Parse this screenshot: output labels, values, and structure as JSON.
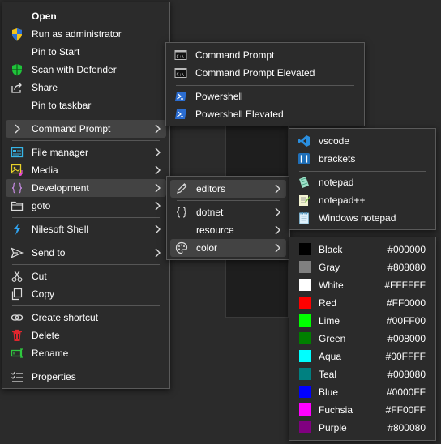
{
  "main_menu": {
    "open": "Open",
    "run_as_admin": "Run as administrator",
    "pin_to_start": "Pin to Start",
    "scan_defender": "Scan with Defender",
    "share": "Share",
    "pin_to_taskbar": "Pin to taskbar",
    "command_prompt": "Command Prompt",
    "file_manager": "File manager",
    "media": "Media",
    "development": "Development",
    "goto": "goto",
    "nilesoft_shell": "Nilesoft Shell",
    "send_to": "Send to",
    "cut": "Cut",
    "copy": "Copy",
    "create_shortcut": "Create shortcut",
    "delete": "Delete",
    "rename": "Rename",
    "properties": "Properties"
  },
  "cmd_menu": {
    "command_prompt": "Command Prompt",
    "command_prompt_elevated": "Command Prompt Elevated",
    "powershell": "Powershell",
    "powershell_elevated": "Powershell Elevated"
  },
  "dev_menu": {
    "editors": "editors",
    "dotnet": "dotnet",
    "resource": "resource",
    "color": "color"
  },
  "editors_menu": {
    "vscode": "vscode",
    "brackets": "brackets",
    "notepad": "notepad",
    "notepadpp": "notepad++",
    "windows_notepad": "Windows notepad"
  },
  "colors": [
    {
      "name": "Black",
      "hex": "#000000"
    },
    {
      "name": "Gray",
      "hex": "#808080"
    },
    {
      "name": "White",
      "hex": "#FFFFFF"
    },
    {
      "name": "Red",
      "hex": "#FF0000"
    },
    {
      "name": "Lime",
      "hex": "#00FF00"
    },
    {
      "name": "Green",
      "hex": "#008000"
    },
    {
      "name": "Aqua",
      "hex": "#00FFFF"
    },
    {
      "name": "Teal",
      "hex": "#008080"
    },
    {
      "name": "Blue",
      "hex": "#0000FF"
    },
    {
      "name": "Fuchsia",
      "hex": "#FF00FF"
    },
    {
      "name": "Purple",
      "hex": "#800080"
    }
  ]
}
